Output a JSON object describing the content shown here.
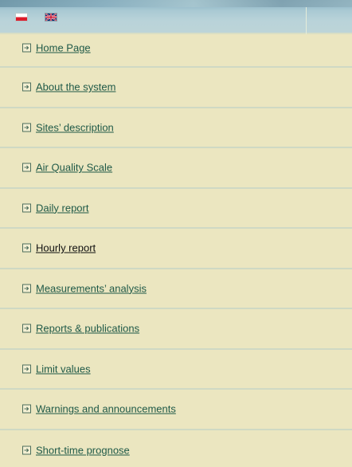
{
  "languages": [
    {
      "code": "pl",
      "icon": "poland-flag-icon"
    },
    {
      "code": "en",
      "icon": "uk-flag-icon"
    }
  ],
  "menu": {
    "items": [
      {
        "label": "Home Page"
      },
      {
        "label": "About the system"
      },
      {
        "label": "Sites’ description"
      },
      {
        "label": "Air Quality Scale"
      },
      {
        "label": "Daily report"
      },
      {
        "label": "Hourly report",
        "active": true
      },
      {
        "label": "Measurements’ analysis"
      },
      {
        "label": "Reports & publications"
      },
      {
        "label": "Limit values"
      },
      {
        "label": "Warnings and announcements"
      },
      {
        "label": "Short-time prognose"
      }
    ]
  },
  "colors": {
    "menu_background": "#ebe6c0",
    "link": "#205a48",
    "active_link": "#111111",
    "divider": "#cfd9c4",
    "header_band": "#a9c9d3"
  }
}
